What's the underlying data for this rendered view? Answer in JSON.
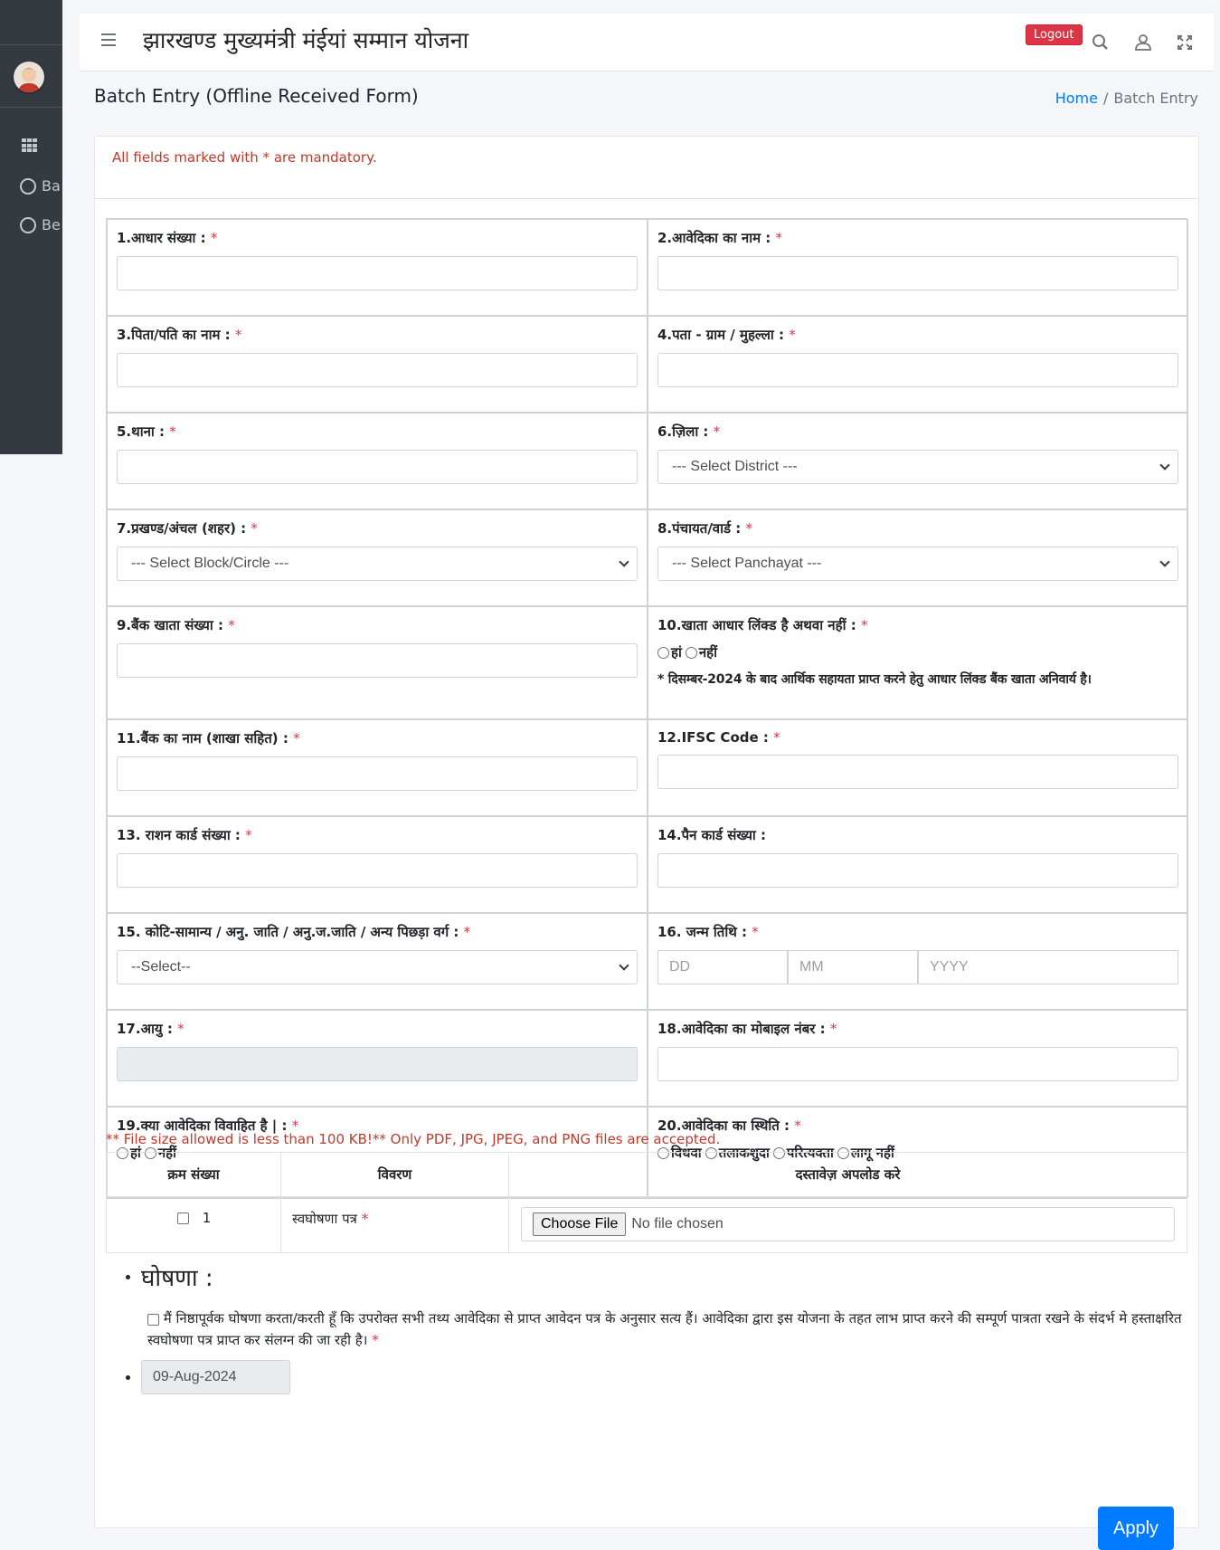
{
  "header": {
    "app_title": "झारखण्ड मुख्यमंत्री मंईयां सम्मान योजना",
    "logout_label": "Logout"
  },
  "sidebar": {
    "items": [
      {
        "label": "Ba",
        "icon": "circle-icon"
      },
      {
        "label": "Be",
        "icon": "circle-icon"
      }
    ]
  },
  "page": {
    "title": "Batch Entry (Offline Received Form)",
    "breadcrumb_home": "Home",
    "breadcrumb_separator": "/",
    "breadcrumb_current": "Batch Entry",
    "mandatory_note": "All fields marked with * are mandatory."
  },
  "form": {
    "required_mark": "*",
    "fields": {
      "aadhaar": "1.आधार संख्या :",
      "applicant_name": "2.आवेदिका का नाम :",
      "father_husband": "3.पिता/पति का नाम :",
      "address": "4.पता - ग्राम / मुहल्ला :",
      "police_station": "5.थाना :",
      "district": "6.ज़िला :",
      "block": "7.प्रखण्ड/अंचल (शहर) :",
      "panchayat": "8.पंचायत/वार्ड :",
      "bank_account": "9.बैंक खाता संख्या :",
      "aadhaar_linked": "10.खाता आधार लिंक्ड है अथवा नहीं :",
      "bank_name": "11.बैंक का नाम (शाखा सहित) :",
      "ifsc": "12.IFSC Code :",
      "ration_card": "13. राशन कार्ड संख्या :",
      "pan_card": "14.पैन कार्ड संख्या :",
      "category": "15. कोटि-सामान्य / अनु. जाति / अनु.ज.जाति / अन्य पिछड़ा वर्ग :",
      "dob": "16. जन्म तिथि :",
      "age": "17.आयु :",
      "mobile": "18.आवेदिका का मोबाइल नंबर :",
      "married": "19.क्या आवेदिका विवाहित है | :",
      "status": "20.आवेदिका का स्थिति :"
    },
    "selects": {
      "district": "--- Select District ---",
      "block": "--- Select Block/Circle ---",
      "panchayat": "--- Select Panchayat ---",
      "category": "--Select--"
    },
    "yes_label": "हां",
    "no_label": "नहीं",
    "aadhaar_note": "* दिसम्बर-2024 के बाद आर्थिक सहायता प्राप्त करने हेतु आधार लिंक्ड बैंक खाता अनिवार्य है।",
    "dob_placeholders": {
      "dd": "DD",
      "mm": "MM",
      "yyyy": "YYYY"
    },
    "status_options": [
      "विधवा",
      "तलाकशुदा",
      "परित्यक्ता",
      "लागू नहीं"
    ]
  },
  "documents": {
    "file_note": "** File size allowed is less than 100 KB!** Only PDF, JPG, JPEG, and PNG files are accepted.",
    "headers": [
      "क्रम संख्या",
      "विवरण",
      "दस्तावेज़ अपलोड करे"
    ],
    "rows": [
      {
        "serial": "1",
        "description": "स्वघोषणा पत्र",
        "file_button": "Choose File",
        "file_status": "No file chosen"
      }
    ]
  },
  "declaration": {
    "heading": "घोषणा :",
    "text": "मैं निष्ठापूर्वक घोषणा करता/करती हूँ कि उपरोक्त सभी तथ्य आवेदिका से प्राप्त आवेदन पत्र के अनुसार सत्य हैं। आवेदिका द्वारा इस योजना के तहत लाभ प्राप्त करने की सम्पूर्ण पात्रता रखने के संदर्भ मे हस्ताक्षरित स्वघोषणा पत्र प्राप्त कर संलग्न की जा रही है।",
    "date": "09-Aug-2024"
  },
  "actions": {
    "apply_label": "Apply"
  }
}
